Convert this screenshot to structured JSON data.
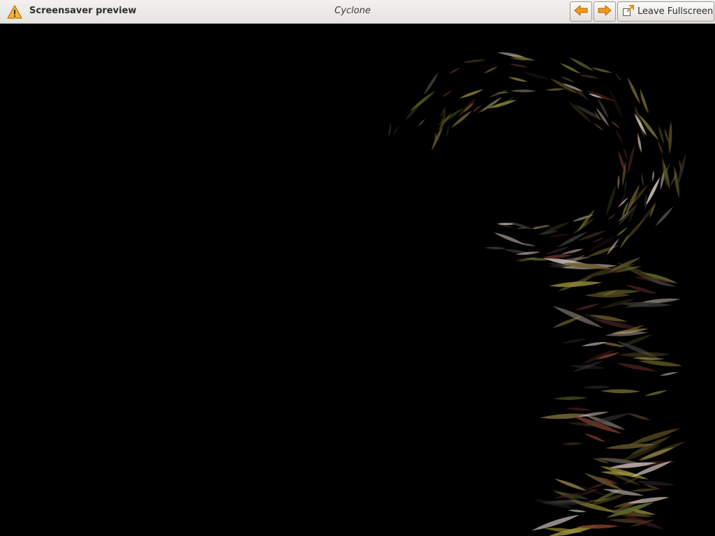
{
  "toolbar": {
    "warning_icon": "warning-icon",
    "title": "Screensaver preview",
    "screensaver_name": "Cyclone",
    "prev_icon": "arrow-left-icon",
    "next_icon": "arrow-right-icon",
    "leave_fullscreen_icon": "leave-fullscreen-icon",
    "leave_fullscreen_label": "Leave Fullscreen"
  },
  "colors": {
    "toolbar_bg": "#ebe9e5",
    "warning": "#f0a020",
    "arrow": "#f08a10",
    "preview_bg": "#000000"
  }
}
